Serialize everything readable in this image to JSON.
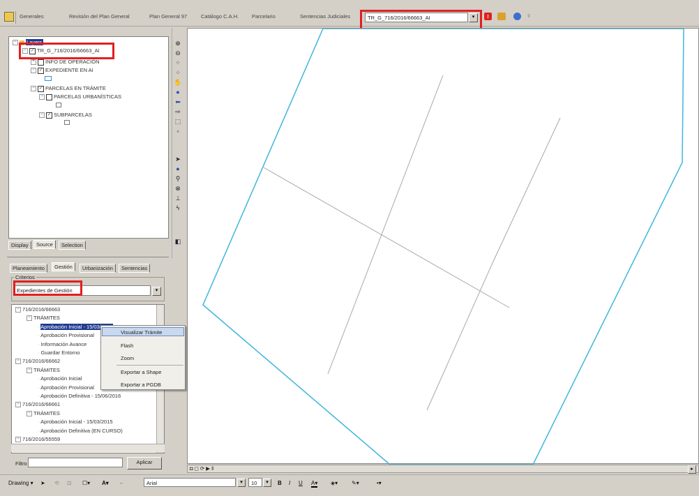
{
  "toolbar": {
    "menus": [
      "Generales",
      "Revisión del Plan General",
      "Plan General 97",
      "Catálogo C.A.H.",
      "Parcelario",
      "Sentencias Judiciales"
    ],
    "layer_combo": "TR_G_716/2016/66663_AI",
    "icons": [
      "grid-icon",
      "info-red-icon",
      "layers-icon",
      "shield-icon",
      "lightbulb-icon"
    ]
  },
  "toc": {
    "root": "Layers",
    "items": [
      {
        "label": "TR_G_716/2016/66663_AI",
        "checked": true
      },
      {
        "label": "INFO DE OPERACIÓN",
        "checked": false
      },
      {
        "label": "EXPEDIENTE EN AI",
        "checked": true
      },
      {
        "label": "PARCELAS EN TRÁMITE",
        "checked": true
      },
      {
        "label": "PARCELAS URBANÍSTICAS",
        "checked": false
      },
      {
        "label": "SUBPARCELAS",
        "checked": true
      }
    ],
    "tabs": [
      "Display",
      "Source",
      "Selection"
    ]
  },
  "gestion": {
    "tabs": [
      "Planeamiento",
      "Gestión",
      "Urbanización",
      "Sentencias"
    ],
    "group_label": "Criterios",
    "criteria_value": "Expedientes de Gestión",
    "tree": [
      {
        "label": "716/2016/66663",
        "level": 0
      },
      {
        "label": "TRÁMITES",
        "level": 1
      },
      {
        "label": "Aprobación Inicial - 15/03/2016",
        "level": 2,
        "selected": true
      },
      {
        "label": "Aprobación Provisional",
        "level": 2
      },
      {
        "label": "Información Avance",
        "level": 2
      },
      {
        "label": "Guardar Entorno",
        "level": 2
      },
      {
        "label": "716/2016/66662",
        "level": 0
      },
      {
        "label": "TRÁMITES",
        "level": 1
      },
      {
        "label": "Aprobación Inicial",
        "level": 2
      },
      {
        "label": "Aprobación Provisional",
        "level": 2
      },
      {
        "label": "Aprobación Definitiva - 15/06/2016",
        "level": 2
      },
      {
        "label": "716/2016/66661",
        "level": 0
      },
      {
        "label": "TRÁMITES",
        "level": 1
      },
      {
        "label": "Aprobación Inicial - 15/03/2015",
        "level": 2
      },
      {
        "label": "Aprobación Definitiva (EN CURSO)",
        "level": 2
      },
      {
        "label": "716/2016/55559",
        "level": 0
      }
    ],
    "filter_label": "Filtro",
    "filter_value": "",
    "apply_label": "Aplicar"
  },
  "context_menu": {
    "items": [
      "Visualizar Trámite",
      "Flash",
      "Zoom",
      "Exportar a Shape",
      "Exportar a PGDB"
    ]
  },
  "map": {
    "nav_controls": "◘ ◻ ⟳ ▶ ‖",
    "colors": {
      "boundary": "#3eb6dc",
      "inner_lines": "#a8a8a8"
    }
  },
  "drawing": {
    "label": "Drawing ▾",
    "font_name": "Arial",
    "font_size": "10",
    "bold": "B",
    "italic": "I",
    "underline": "U"
  }
}
